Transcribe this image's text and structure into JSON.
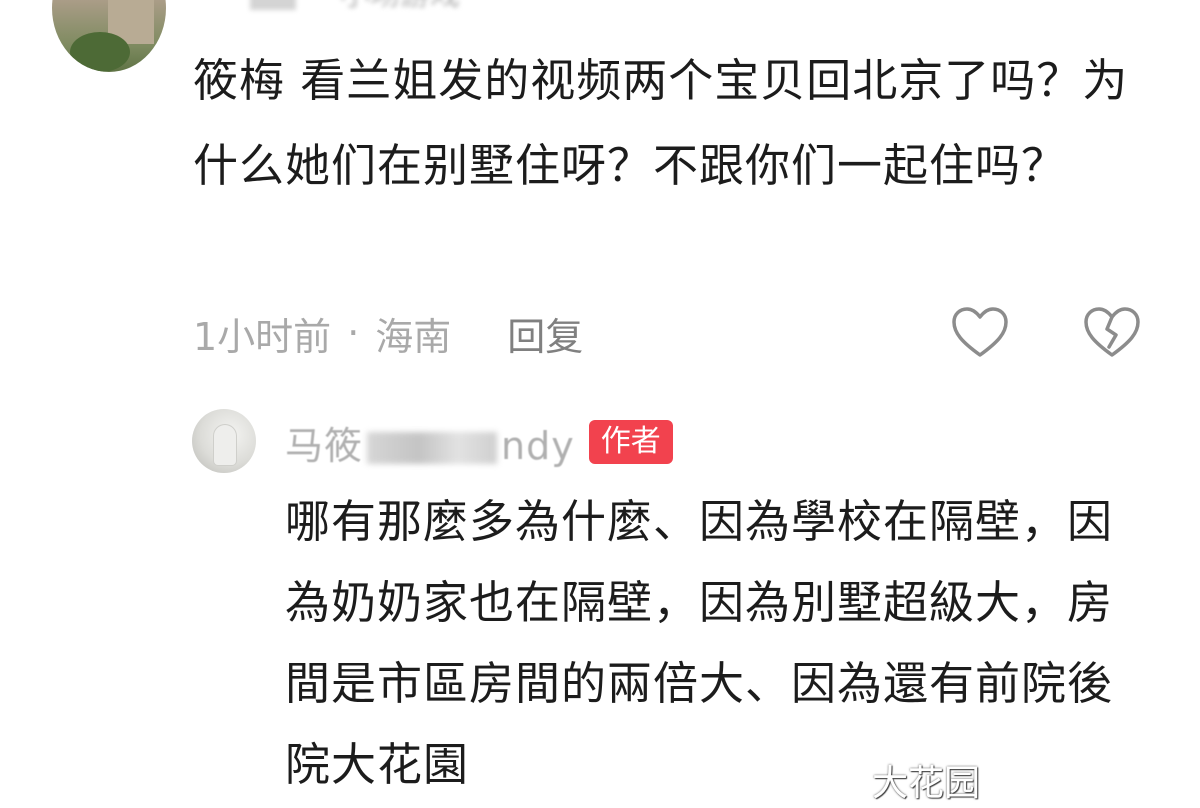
{
  "comment": {
    "username": "一小场游戏",
    "text": "筱梅 看兰姐发的视频两个宝贝回北京了吗？为什么她们在别墅住呀？不跟你们一起住吗？",
    "time": "1小时前",
    "separator": "·",
    "location": "海南",
    "reply_label": "回复"
  },
  "reply": {
    "username_start": "马筱",
    "username_end": "ndy",
    "badge": "作者",
    "text": "哪有那麼多為什麼、因為學校在隔壁，因為奶奶家也在隔壁，因為別墅超級大，房間是市區房間的兩倍大、因為還有前院後院大花園"
  },
  "icons": {
    "like": "heart-outline-icon",
    "dislike": "broken-heart-icon"
  },
  "watermark": {
    "text": "大花园"
  },
  "colors": {
    "badge": "#f2424e",
    "body_text": "#1c1c1c",
    "meta_text": "#a9a9a9"
  }
}
